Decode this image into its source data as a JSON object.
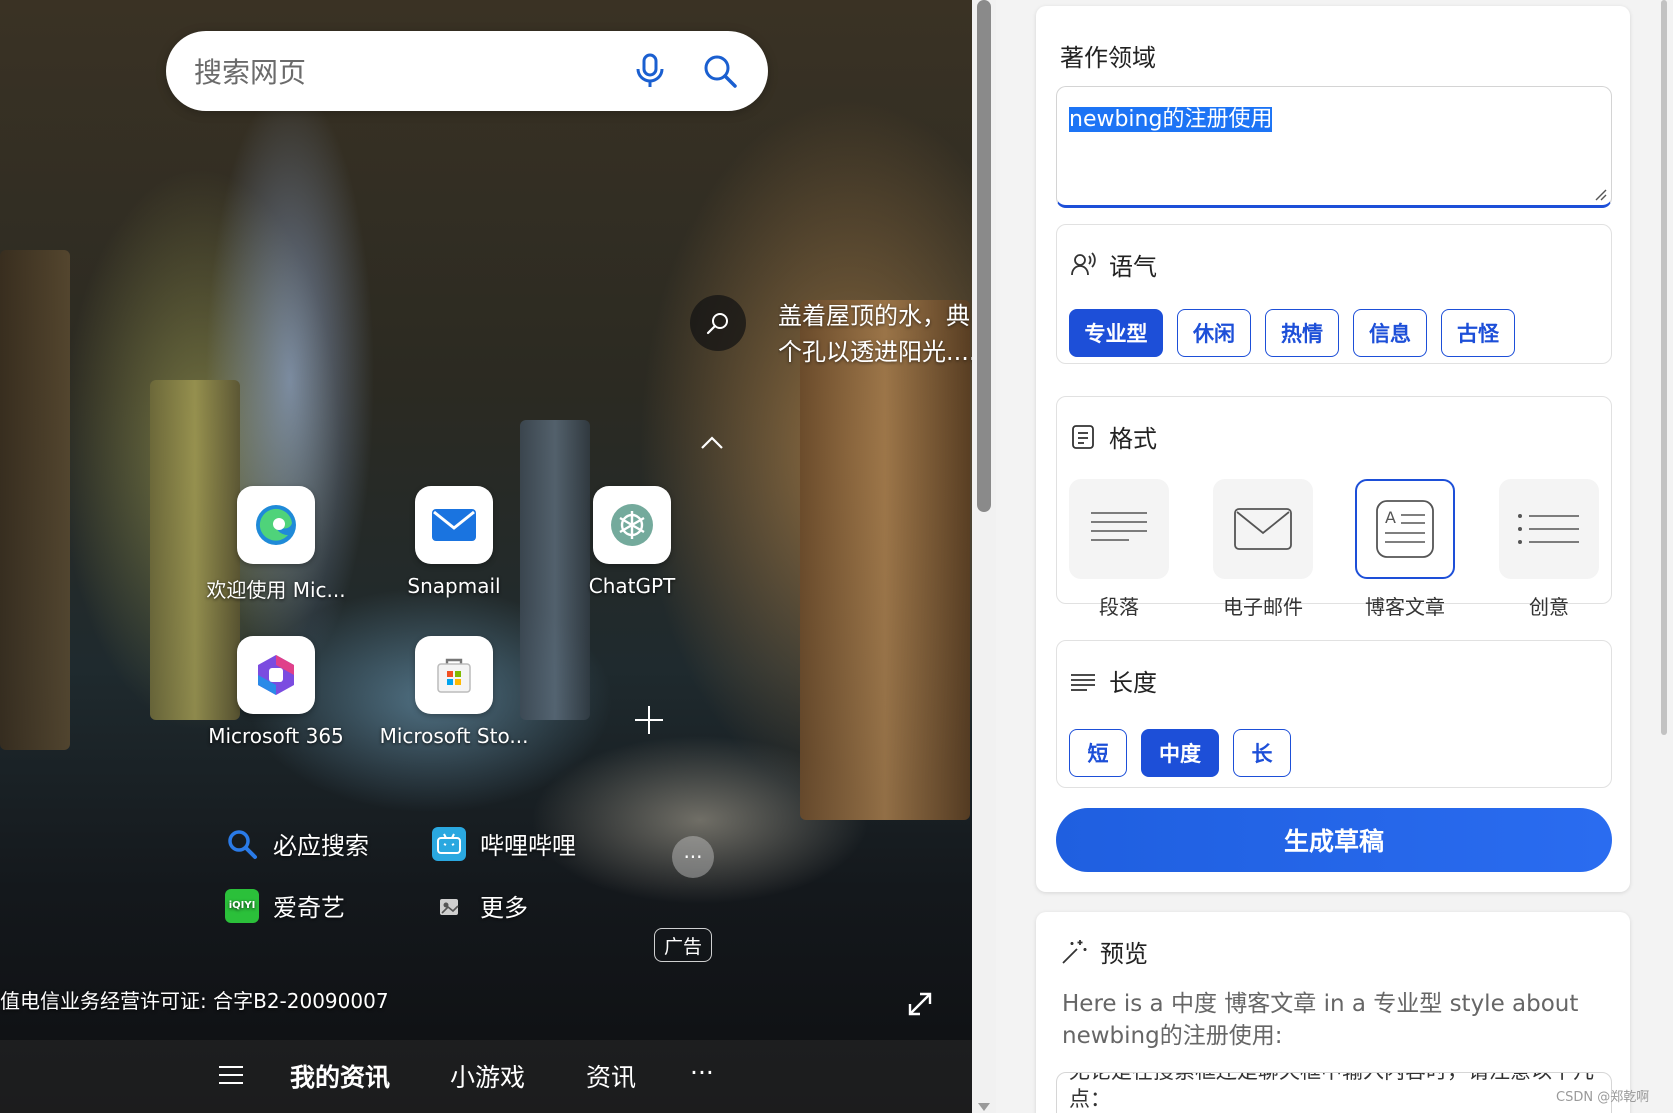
{
  "newtab": {
    "search_placeholder": "搜索网页",
    "image_caption": "盖着屋顶的水，典\n个孔以透进阳光....",
    "tiles": [
      {
        "label": "欢迎使用 Mic..."
      },
      {
        "label": "Snapmail"
      },
      {
        "label": "ChatGPT"
      },
      {
        "label": "Microsoft 365"
      },
      {
        "label": "Microsoft Sto..."
      }
    ],
    "quick_links": [
      {
        "label": "必应搜索"
      },
      {
        "label": "哔哩哔哩"
      },
      {
        "label": "爱奇艺"
      },
      {
        "label": "更多"
      }
    ],
    "ad_label": "广告",
    "license_text": "值电信业务经营许可证: 合字B2-20090007",
    "bottom_nav": {
      "my_feed": "我的资讯",
      "games": "小游戏",
      "news": "资讯",
      "more": "···"
    }
  },
  "compose": {
    "topic_label": "著作领域",
    "topic_value": "newbing的注册使用",
    "tone": {
      "title": "语气",
      "options": [
        "专业型",
        "休闲",
        "热情",
        "信息",
        "古怪"
      ],
      "selected": "专业型"
    },
    "format": {
      "title": "格式",
      "options": [
        "段落",
        "电子邮件",
        "博客文章",
        "创意"
      ],
      "selected": "博客文章"
    },
    "length": {
      "title": "长度",
      "options": [
        "短",
        "中度",
        "长"
      ],
      "selected": "中度"
    },
    "generate_label": "生成草稿",
    "preview": {
      "title": "预览",
      "text": "Here is a 中度 博客文章 in a 专业型 style about newbing的注册使用:",
      "box_text": "无论是在搜索框还是聊天框中输入内容时，请注意以下几点："
    }
  },
  "watermark": "CSDN @郑乾啊",
  "colors": {
    "accent": "#1d4fd8",
    "generate_button": "#1f5fe0"
  }
}
